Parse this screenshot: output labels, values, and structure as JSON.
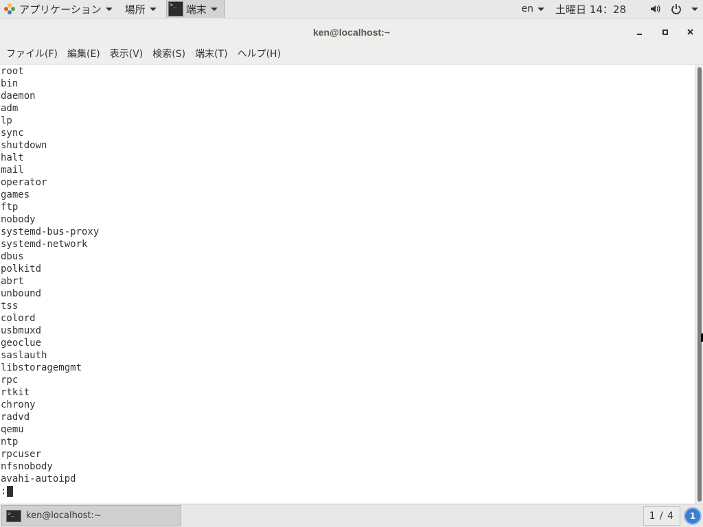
{
  "top_panel": {
    "apps_label": "アプリケーション",
    "places_label": "場所",
    "task_label": "端末",
    "lang": "en",
    "clock": "土曜日 14：28"
  },
  "window": {
    "title": "ken@localhost:~"
  },
  "menu": {
    "items": [
      "ファイル(F)",
      "編集(E)",
      "表示(V)",
      "検索(S)",
      "端末(T)",
      "ヘルプ(H)"
    ]
  },
  "terminal": {
    "lines": [
      "root",
      "bin",
      "daemon",
      "adm",
      "lp",
      "sync",
      "shutdown",
      "halt",
      "mail",
      "operator",
      "games",
      "ftp",
      "nobody",
      "systemd-bus-proxy",
      "systemd-network",
      "dbus",
      "polkitd",
      "abrt",
      "unbound",
      "tss",
      "colord",
      "usbmuxd",
      "geoclue",
      "saslauth",
      "libstoragemgmt",
      "rpc",
      "rtkit",
      "chrony",
      "radvd",
      "qemu",
      "ntp",
      "rpcuser",
      "nfsnobody",
      "avahi-autoipd"
    ],
    "prompt": ":"
  },
  "bottom_panel": {
    "task_label": "ken@localhost:~",
    "workspace": "1 / 4",
    "notification_count": "1"
  },
  "icons": {
    "apps": "apps-icon",
    "terminal": "terminal-icon",
    "volume": "volume-icon",
    "power": "power-icon",
    "minimize": "minimize-icon",
    "maximize": "maximize-icon",
    "close": "close-icon"
  }
}
